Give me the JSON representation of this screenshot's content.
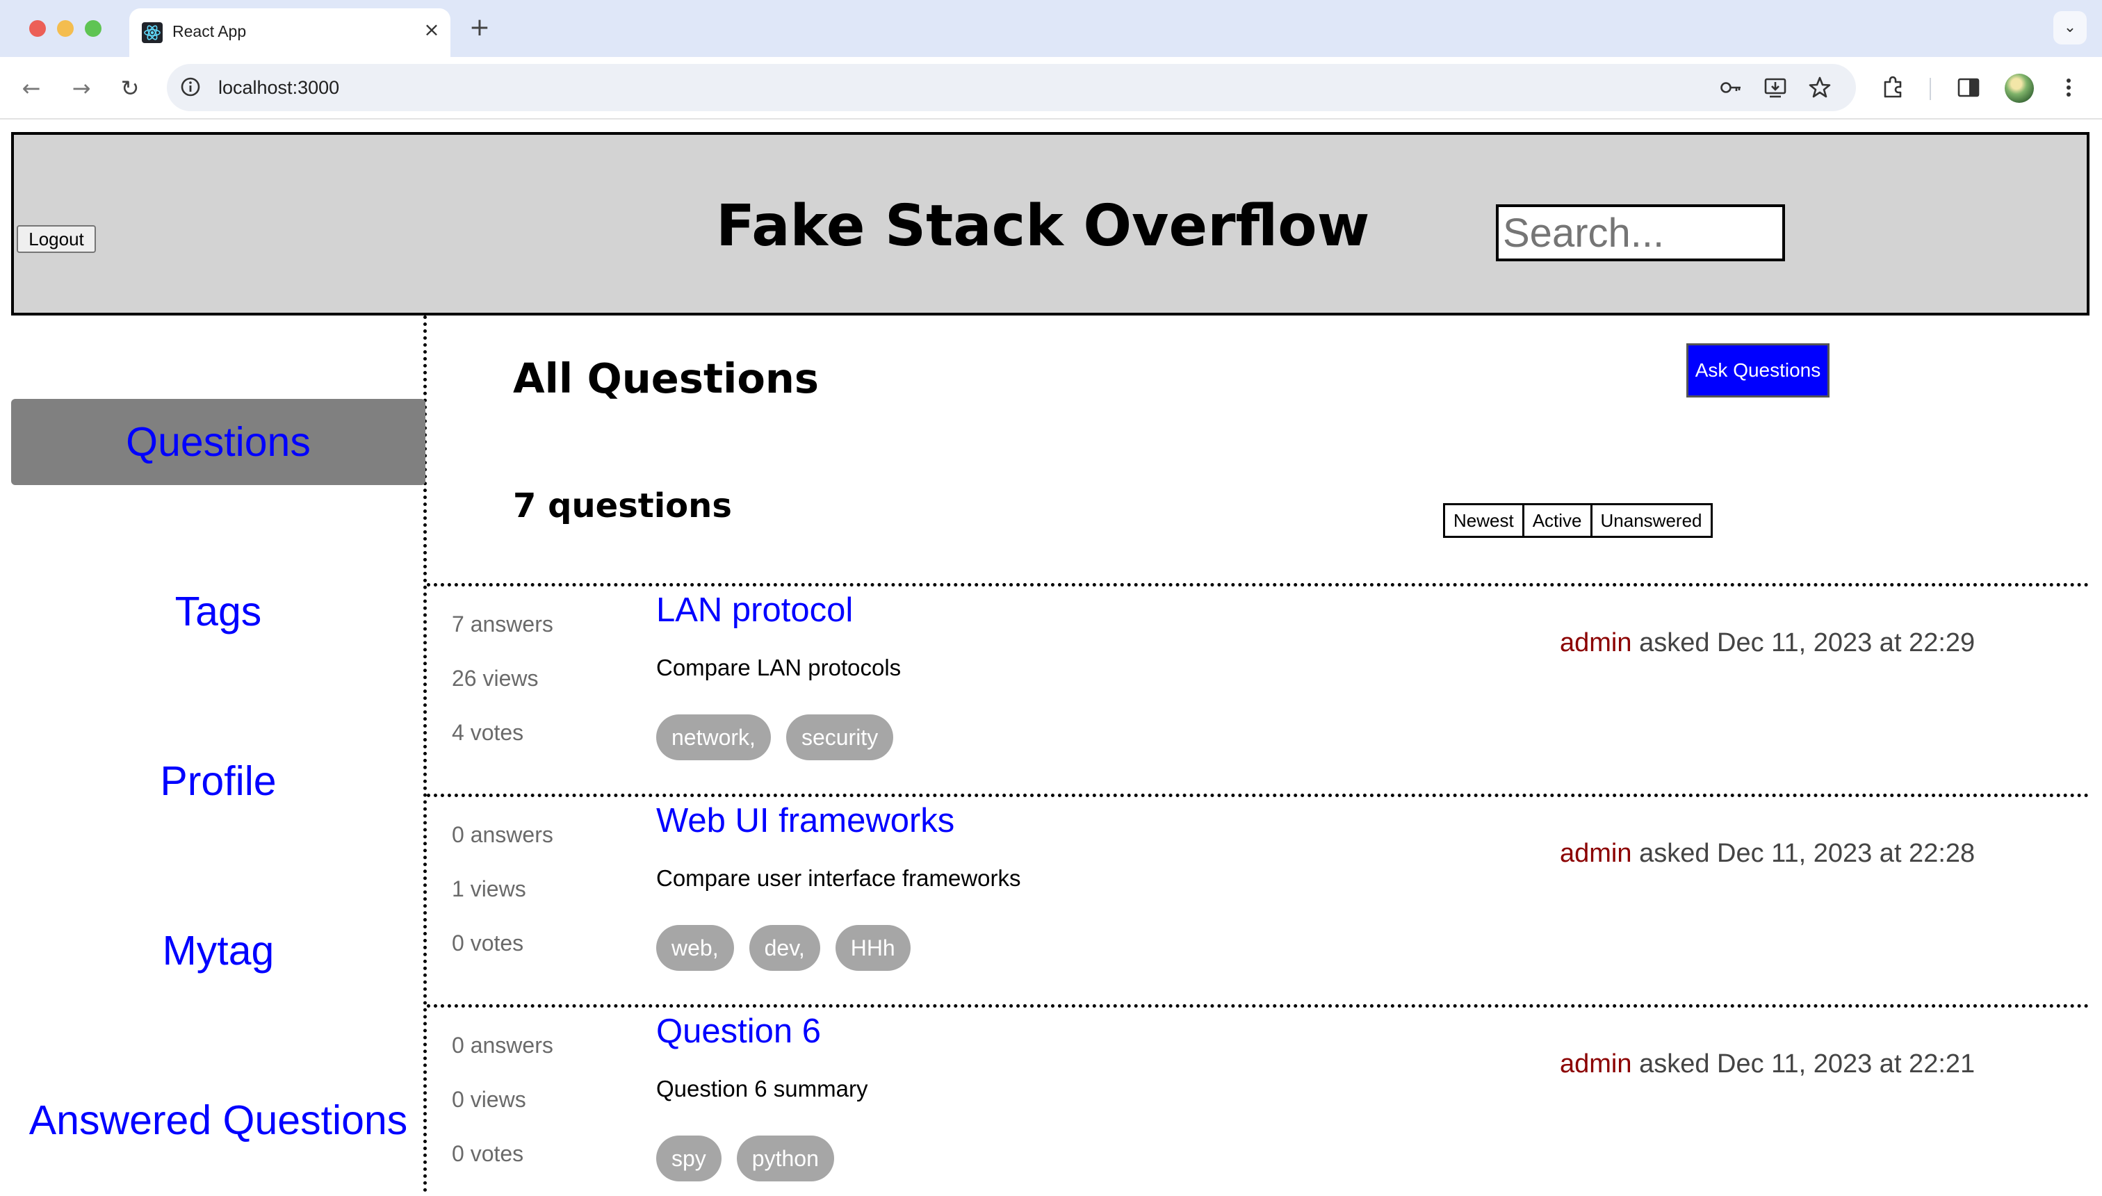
{
  "browser": {
    "tab_title": "React App",
    "tab_close": "×",
    "new_tab": "+",
    "url": "localhost:3000"
  },
  "header": {
    "title": "Fake Stack Overflow",
    "logout_label": "Logout",
    "search_placeholder": "Search..."
  },
  "sidebar": {
    "items": [
      {
        "label": "Questions",
        "active": true
      },
      {
        "label": "Tags"
      },
      {
        "label": "Profile"
      },
      {
        "label": "Mytag"
      },
      {
        "label": "Answered Questions"
      }
    ]
  },
  "main": {
    "heading": "All Questions",
    "ask_label": "Ask Questions",
    "count_label": "7 questions",
    "sort": [
      "Newest",
      "Active",
      "Unanswered"
    ],
    "questions": [
      {
        "answers": "7 answers",
        "views": "26 views",
        "votes": "4 votes",
        "title": "LAN protocol",
        "summary": "Compare LAN protocols",
        "tags": [
          "network,",
          "security"
        ],
        "author": "admin",
        "asked": "asked Dec 11, 2023 at 22:29"
      },
      {
        "answers": "0 answers",
        "views": "1 views",
        "votes": "0 votes",
        "title": "Web UI frameworks",
        "summary": "Compare user interface frameworks",
        "tags": [
          "web,",
          "dev,",
          "HHh"
        ],
        "author": "admin",
        "asked": "asked Dec 11, 2023 at 22:28"
      },
      {
        "answers": "0 answers",
        "views": "0 views",
        "votes": "0 votes",
        "title": "Question 6",
        "summary": "Question 6 summary",
        "tags": [
          "spy",
          "python"
        ],
        "author": "admin",
        "asked": "asked Dec 11, 2023 at 22:21"
      }
    ]
  },
  "colors": {
    "link_blue": "#0000ff",
    "author_red": "#8b0000",
    "header_gray": "#d3d3d3",
    "active_nav_gray": "#808080",
    "tag_gray": "#a6a6a6"
  }
}
